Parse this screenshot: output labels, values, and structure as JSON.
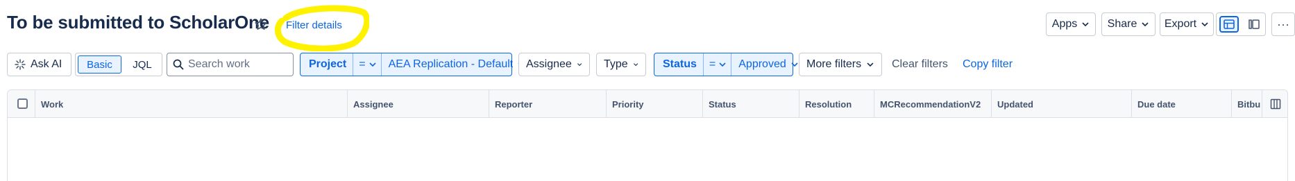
{
  "header": {
    "title": "To be submitted to ScholarOne",
    "filter_details": "Filter details",
    "apps": "Apps",
    "share": "Share",
    "export": "Export",
    "more": "···"
  },
  "toolbar": {
    "ask_ai": "Ask AI",
    "basic": "Basic",
    "jql": "JQL",
    "search_placeholder": "Search work",
    "project": {
      "name": "Project",
      "operator": "=",
      "value": "AEA Replication - Default"
    },
    "assignee": "Assignee",
    "type": "Type",
    "status": {
      "name": "Status",
      "operator": "=",
      "value": "Approved"
    },
    "more_filters": "More filters",
    "clear_filters": "Clear filters",
    "copy_filter": "Copy filter"
  },
  "table": {
    "columns": [
      "Work",
      "Assignee",
      "Reporter",
      "Priority",
      "Status",
      "Resolution",
      "MCRecommendationV2",
      "Updated",
      "Due date",
      "Bitbu"
    ]
  },
  "colors": {
    "accent": "#0c66e4",
    "accent_bg": "#e9f2ff",
    "highlight": "#fff200",
    "text": "#172b4d"
  },
  "icons": [
    "star-icon",
    "chevron-down-icon",
    "sparkle-icon",
    "search-icon",
    "list-view-icon",
    "detail-view-icon",
    "column-config-icon",
    "more-icon"
  ]
}
